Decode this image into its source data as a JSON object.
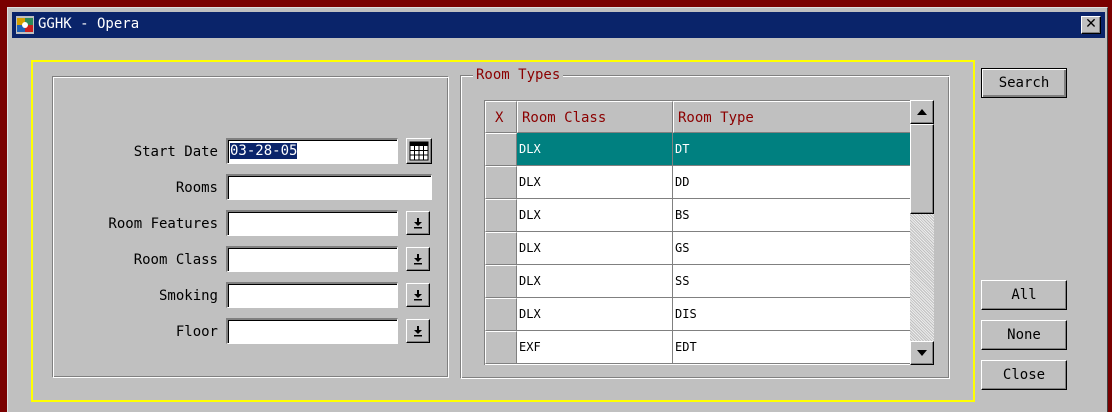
{
  "window": {
    "title": "GGHK - Opera",
    "close_glyph": "✕"
  },
  "form": {
    "start_date_label": "Start Date",
    "start_date_value": "03-28-05",
    "rooms_label": "Rooms",
    "rooms_value": "",
    "room_features_label": "Room Features",
    "room_features_value": "",
    "room_class_label": "Room Class",
    "room_class_value": "",
    "smoking_label": "Smoking",
    "smoking_value": "",
    "floor_label": "Floor",
    "floor_value": ""
  },
  "room_types": {
    "group_label": "Room Types",
    "columns": [
      "X",
      "Room Class",
      "Room Type"
    ],
    "rows": [
      {
        "room_class": "DLX",
        "room_type": "DT",
        "selected": true
      },
      {
        "room_class": "DLX",
        "room_type": "DD",
        "selected": false
      },
      {
        "room_class": "DLX",
        "room_type": "BS",
        "selected": false
      },
      {
        "room_class": "DLX",
        "room_type": "GS",
        "selected": false
      },
      {
        "room_class": "DLX",
        "room_type": "SS",
        "selected": false
      },
      {
        "room_class": "DLX",
        "room_type": "DIS",
        "selected": false
      },
      {
        "room_class": "EXF",
        "room_type": "EDT",
        "selected": false
      }
    ]
  },
  "buttons": {
    "search": "Search",
    "all": "All",
    "none": "None",
    "close": "Close"
  },
  "colors": {
    "title_bar": "#0a246a",
    "selected_row": "#008080",
    "frame_highlight": "#ffff00",
    "header_text": "#8b0000",
    "outer_border": "#7a0000"
  },
  "icons": {
    "app": "opera-app-icon",
    "calendar": "calendar-icon",
    "dropdown": "dropdown-arrow-icon"
  }
}
